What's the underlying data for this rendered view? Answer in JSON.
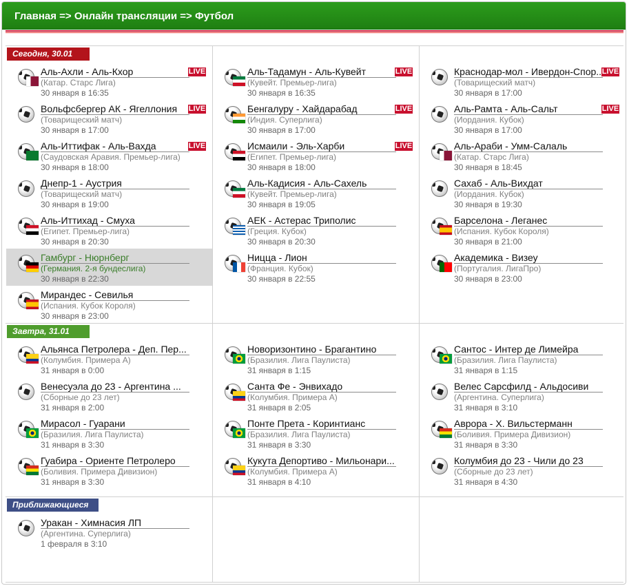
{
  "breadcrumb": {
    "text": "Главная => Онлайн трансляции => Футбол"
  },
  "sections": {
    "today": {
      "label": "Сегодня, 30.01"
    },
    "tomorrow": {
      "label": "Завтра, 31.01"
    },
    "upcoming": {
      "label": "Приближающиеся"
    }
  },
  "live_label": "LIVE",
  "colors": {
    "header_green": "#249018",
    "today_red": "#b3141b",
    "tomorrow_green": "#4f9d2d",
    "upcoming_blue": "#3e4f86",
    "live_red": "#c8102e",
    "highlight_green": "#3a7d2a"
  },
  "matches": [
    {
      "teams": "Аль-Ахли - Аль-Кхор",
      "league": "(Катар. Старс Лига)",
      "time": "30 января в 16:35",
      "live": true,
      "flag": "qatar"
    },
    {
      "teams": "Вольфсбергер АК - Ягеллония",
      "league": "(Товарищеский матч)",
      "time": "30 января в 17:00",
      "live": true,
      "flag": ""
    },
    {
      "teams": "Аль-Иттифак - Аль-Вахда",
      "league": "(Саудовская Аравия. Премьер-лига)",
      "time": "30 января в 18:00",
      "live": true,
      "flag": "saudi"
    },
    {
      "teams": "Днепр-1 - Аустрия",
      "league": "(Товарищеский матч)",
      "time": "30 января в 19:00",
      "live": false,
      "flag": ""
    },
    {
      "teams": "Аль-Иттихад - Смуха",
      "league": "(Египет. Премьер-лига)",
      "time": "30 января в 20:30",
      "live": false,
      "flag": "egypt"
    },
    {
      "teams": "Гамбург - Нюрнберг",
      "league": "(Германия. 2-я бундеслига)",
      "time": "30 января в 22:30",
      "live": false,
      "flag": "germany",
      "highlight": true
    },
    {
      "teams": "Мирандес - Севилья",
      "league": "(Испания. Кубок Короля)",
      "time": "30 января в 23:00",
      "live": false,
      "flag": "spain"
    },
    {
      "teams": "Аль-Тадамун - Аль-Кувейт",
      "league": "(Кувейт. Премьер-лига)",
      "time": "30 января в 16:35",
      "live": true,
      "flag": "kuwait"
    },
    {
      "teams": "Бенгалуру - Хайдарабад",
      "league": "(Индия. Суперлига)",
      "time": "30 января в 17:00",
      "live": true,
      "flag": "india"
    },
    {
      "teams": "Исмаили - Эль-Харби",
      "league": "(Египет. Премьер-лига)",
      "time": "30 января в 18:00",
      "live": true,
      "flag": "egypt"
    },
    {
      "teams": "Аль-Кадисия - Аль-Сахель",
      "league": "(Кувейт. Премьер-лига)",
      "time": "30 января в 19:05",
      "live": false,
      "flag": "kuwait"
    },
    {
      "teams": "АЕК - Астерас Триполис",
      "league": "(Греция. Кубок)",
      "time": "30 января в 20:30",
      "live": false,
      "flag": "greece"
    },
    {
      "teams": "Ницца - Лион",
      "league": "(Франция. Кубок)",
      "time": "30 января в 22:55",
      "live": false,
      "flag": "france"
    },
    {
      "teams": "Краснодар-мол - Ивердон-Спор...",
      "league": "(Товарищеский матч)",
      "time": "30 января в 17:00",
      "live": true,
      "flag": ""
    },
    {
      "teams": "Аль-Рамта - Аль-Сальт",
      "league": "(Иордания. Кубок)",
      "time": "30 января в 17:00",
      "live": true,
      "flag": ""
    },
    {
      "teams": "Аль-Араби - Умм-Салаль",
      "league": "(Катар. Старс Лига)",
      "time": "30 января в 18:45",
      "live": false,
      "flag": "qatar"
    },
    {
      "teams": "Сахаб - Аль-Вихдат",
      "league": "(Иордания. Кубок)",
      "time": "30 января в 19:30",
      "live": false,
      "flag": ""
    },
    {
      "teams": "Барселона - Леганес",
      "league": "(Испания. Кубок Короля)",
      "time": "30 января в 21:00",
      "live": false,
      "flag": "spain"
    },
    {
      "teams": "Академика - Визеу",
      "league": "(Португалия. ЛигаПро)",
      "time": "30 января в 23:00",
      "live": false,
      "flag": "portugal"
    },
    {
      "teams": "Альянса Петролера - Деп. Пер...",
      "league": "(Колумбия. Примера А)",
      "time": "31 января в 0:00",
      "live": false,
      "flag": "colombia"
    },
    {
      "teams": "Венесуэла до 23 - Аргентина ...",
      "league": "(Сборные до 23 лет)",
      "time": "31 января в 2:00",
      "live": false,
      "flag": ""
    },
    {
      "teams": "Мирасол - Гуарани",
      "league": "(Бразилия. Лига Паулиста)",
      "time": "31 января в 3:30",
      "live": false,
      "flag": "brazil"
    },
    {
      "teams": "Гуабира - Ориенте Петролеро",
      "league": "(Боливия. Примера Дивизион)",
      "time": "31 января в 3:30",
      "live": false,
      "flag": "bolivia"
    },
    {
      "teams": "Новоризонтино - Брагантино",
      "league": "(Бразилия. Лига Паулиста)",
      "time": "31 января в 1:15",
      "live": false,
      "flag": "brazil"
    },
    {
      "teams": "Санта Фе - Энвихадо",
      "league": "(Колумбия. Примера А)",
      "time": "31 января в 2:05",
      "live": false,
      "flag": "colombia"
    },
    {
      "teams": "Понте Прета - Коринтианс",
      "league": "(Бразилия. Лига Паулиста)",
      "time": "31 января в 3:30",
      "live": false,
      "flag": "brazil"
    },
    {
      "teams": "Кукута Депортиво - Мильонари...",
      "league": "(Колумбия. Примера А)",
      "time": "31 января в 4:10",
      "live": false,
      "flag": "colombia"
    },
    {
      "teams": "Сантос - Интер де Лимейра",
      "league": "(Бразилия. Лига Паулиста)",
      "time": "31 января в 1:15",
      "live": false,
      "flag": "brazil"
    },
    {
      "teams": "Велес Сарсфилд - Альдосиви",
      "league": "(Аргентина. Суперлига)",
      "time": "31 января в 3:10",
      "live": false,
      "flag": ""
    },
    {
      "teams": "Аврора - Х. Вильстерманн",
      "league": "(Боливия. Примера Дивизион)",
      "time": "31 января в 3:30",
      "live": false,
      "flag": "bolivia"
    },
    {
      "teams": "Колумбия до 23 - Чили до 23",
      "league": "(Сборные до 23 лет)",
      "time": "31 января в 4:30",
      "live": false,
      "flag": ""
    },
    {
      "teams": "Уракан - Химнасия ЛП",
      "league": "(Аргентина. Суперлига)",
      "time": "1 февраля в 3:10",
      "live": false,
      "flag": ""
    }
  ]
}
